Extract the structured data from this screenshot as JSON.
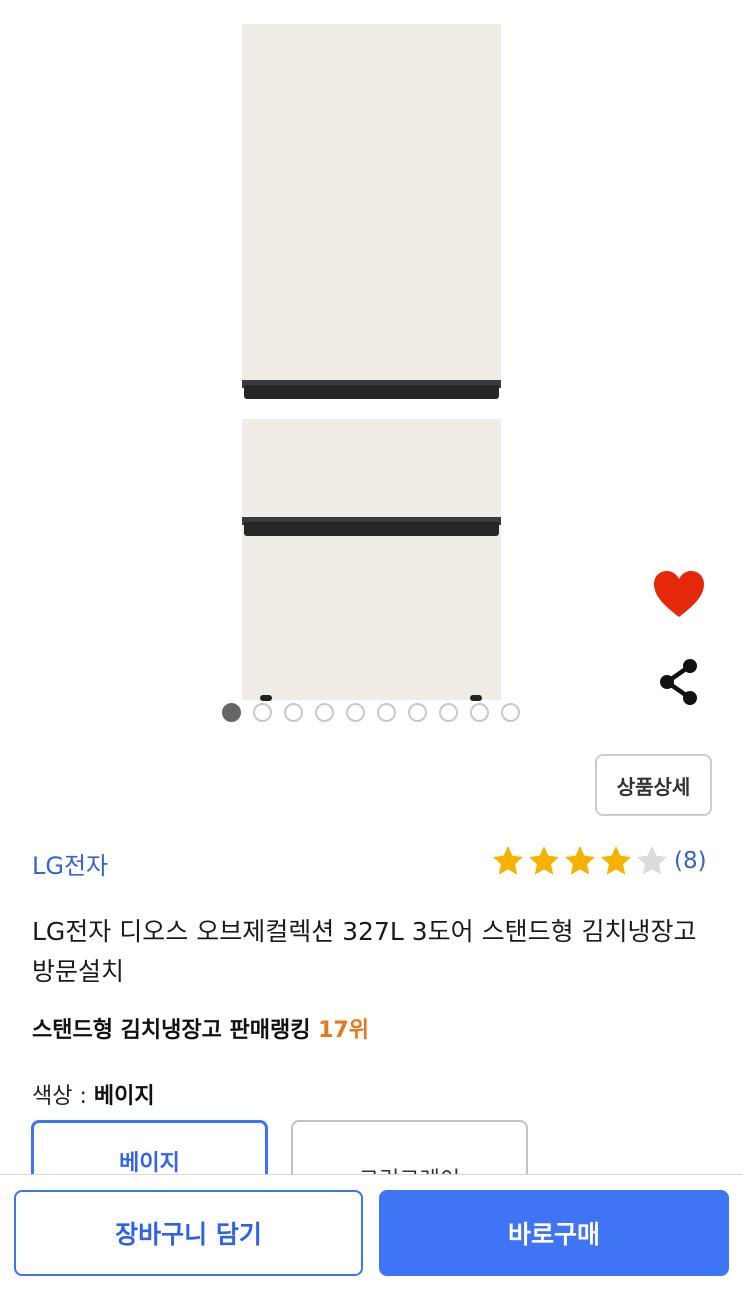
{
  "gallery": {
    "image_alt": "",
    "slide_count": 10,
    "active_slide": 1
  },
  "actions": {
    "wishlist_icon": "heart-icon",
    "wishlist_color": "#e5280a",
    "share_icon": "share-icon"
  },
  "detail_button_label": "상품상세",
  "product": {
    "brand": "LG전자",
    "rating": 4,
    "rating_max": 5,
    "review_count": "(8)",
    "title": "LG전자 디오스 오브제컬렉션 327L 3도어 스탠드형 김치냉장고 방문설치",
    "ranking_prefix": "스탠드형 김치냉장고 판매랭킹",
    "ranking_value": "17위"
  },
  "color_option": {
    "label": "색상 : ",
    "selected": "베이지",
    "options": [
      "베이지",
      "그린그레이"
    ]
  },
  "bottom_bar": {
    "cart_label": "장바구니 담기",
    "buy_label": "바로구매"
  },
  "colors": {
    "accent": "#3f74f5",
    "brand_text": "#3565c8",
    "rank_highlight": "#e8761c",
    "star_filled": "#f5b300",
    "star_empty": "#dcdcdc"
  }
}
